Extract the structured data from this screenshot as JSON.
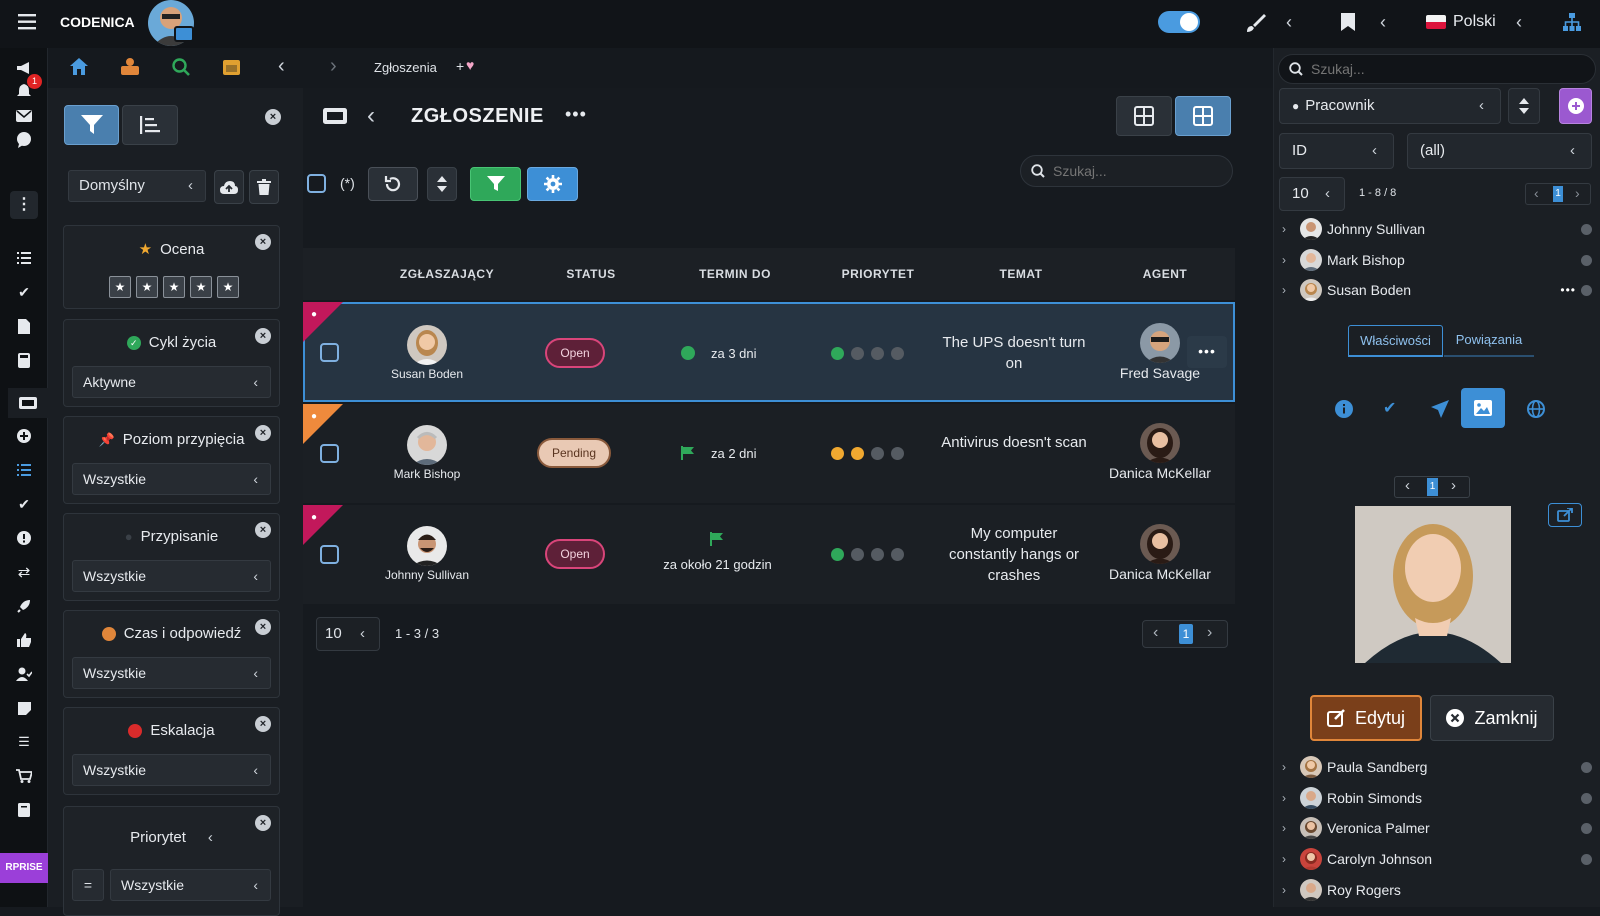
{
  "app": {
    "brand": "CODENICA",
    "notif_count": "1",
    "enterprise_label": "RPRISE"
  },
  "topbar": {
    "language": "Polski"
  },
  "breadcrumb": {
    "current": "Zgłoszenia",
    "add": "+"
  },
  "filters": {
    "preset": "Domyślny",
    "cards": [
      {
        "title": "Ocena",
        "icon": "star-icon",
        "value": ""
      },
      {
        "title": "Cykl życia",
        "icon": "check-circle-icon",
        "value": "Aktywne"
      },
      {
        "title": "Poziom przypięcia",
        "icon": "pin-icon",
        "value": "Wszystkie"
      },
      {
        "title": "Przypisanie",
        "icon": "user-icon",
        "value": "Wszystkie"
      },
      {
        "title": "Czas i odpowiedź",
        "icon": "clock-icon",
        "value": "Wszystkie"
      },
      {
        "title": "Eskalacja",
        "icon": "alert-icon",
        "value": "Wszystkie"
      },
      {
        "title": "Priorytet",
        "icon": "",
        "value": "Wszystkie",
        "op": "="
      }
    ]
  },
  "main": {
    "title": "ZGŁOSZENIE",
    "select_all_hint": "(*)",
    "search_placeholder": "Szukaj...",
    "columns": [
      "ZGŁASZAJĄCY",
      "STATUS",
      "TERMIN DO",
      "PRIORYTET",
      "TEMAT",
      "AGENT"
    ],
    "rows": [
      {
        "reporter": "Susan Boden",
        "status": "Open",
        "due": "za 3 dni",
        "priority": 1,
        "subject": "The UPS doesn't turn on",
        "agent": "Fred Savage",
        "ribbon": "#c2185b"
      },
      {
        "reporter": "Mark Bishop",
        "status": "Pending",
        "due": "za 2 dni",
        "priority": 2,
        "subject": "Antivirus doesn't scan",
        "agent": "Danica McKellar",
        "ribbon": "#ef8a3c"
      },
      {
        "reporter": "Johnny Sullivan",
        "status": "Open",
        "due": "za około 21 godzin",
        "priority": 1,
        "subject": "My computer constantly hangs or crashes",
        "agent": "Danica McKellar",
        "ribbon": "#c2185b"
      }
    ],
    "page_size": "10",
    "range": "1 - 3 / 3",
    "page": "1"
  },
  "right": {
    "search_placeholder": "Szukaj...",
    "entity": "Pracownik",
    "field": "ID",
    "field_value": "(all)",
    "page_size": "10",
    "range": "1 - 8 / 8",
    "page": "1",
    "tree_top": [
      "Johnny Sullivan",
      "Mark Bishop",
      "Susan Boden"
    ],
    "tabs": [
      "Właściwości",
      "Powiązania"
    ],
    "photo_page": "1",
    "edit_label": "Edytuj",
    "close_label": "Zamknij",
    "tree_bottom": [
      "Paula Sandberg",
      "Robin Simonds",
      "Veronica Palmer",
      "Carolyn Johnson",
      "Roy Rogers"
    ]
  },
  "colors": {
    "accent": "#3d8fd6",
    "green": "#2fa85a",
    "orange": "#e0863a",
    "purple": "#9b59d0"
  }
}
